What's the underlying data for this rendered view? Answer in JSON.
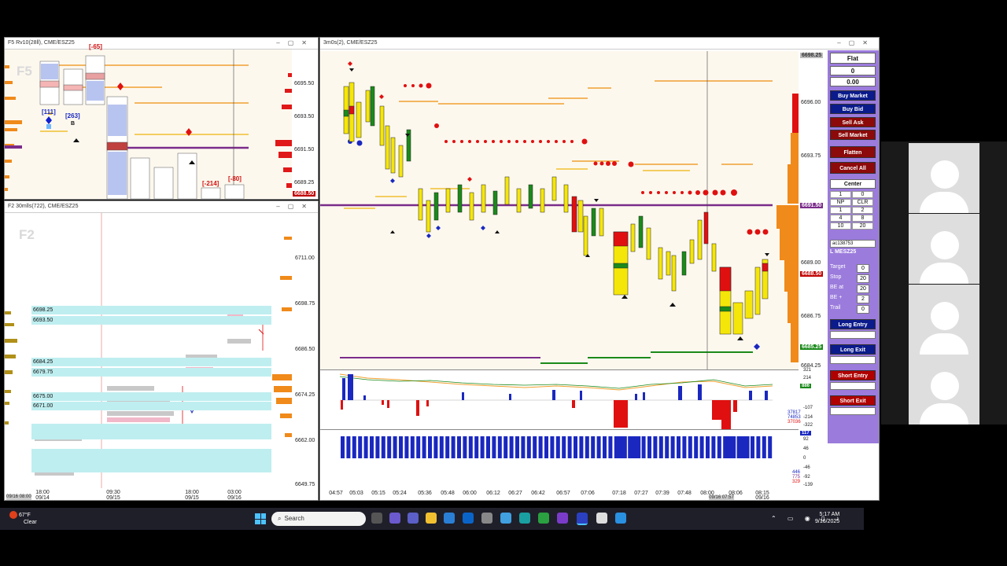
{
  "windows": {
    "f5": {
      "title": "F5 Rv10(28ll), CME/ESZ25",
      "watermark": "F5",
      "prices": [
        "6695.50",
        "6693.50",
        "6691.50",
        "6689.25"
      ],
      "last_price": "6688.50",
      "annotations": [
        "[-65]",
        "[111]",
        "[263]",
        "B",
        "[-214]",
        "[-80]"
      ]
    },
    "f2": {
      "title": "F2 30mlls(722), CME/ESZ25",
      "watermark": "F2",
      "prices": [
        "6711.00",
        "6698.75",
        "6686.50",
        "6674.25",
        "6662.00",
        "6649.75"
      ],
      "ladder": [
        "6698.25",
        "6693.50",
        "6684.25",
        "6679.75",
        "6675.00",
        "6671.00"
      ],
      "times": [
        "18:00\n09/14",
        "09:30\n09/15",
        "18:00\n09/15",
        "03:00\n09/16"
      ],
      "corner_label": "09/16 08:00"
    },
    "main": {
      "title": "3m0s(2), CME/ESZ25",
      "prices": [
        "6696.00",
        "6693.75",
        "6691.50",
        "6689.00",
        "6686.75",
        "6684.25"
      ],
      "price_tags": {
        "top": "6698.25",
        "poc": "6691.50",
        "last": "6688.50",
        "low": "6685.25"
      },
      "osc_labels": [
        "321",
        "214",
        "107",
        "0",
        "-107",
        "-214",
        "-322"
      ],
      "osc_values": [
        "37817",
        "74853",
        "37036"
      ],
      "osc_tag": "886",
      "vol_labels": [
        "92",
        "46",
        "0",
        "-46",
        "-92",
        "-139"
      ],
      "vol_values": [
        "446",
        "775",
        "329"
      ],
      "vol_tag": "117",
      "times": [
        "04:57",
        "05:03",
        "05:15",
        "05:24",
        "05:36",
        "05:48",
        "06:00",
        "06:12",
        "06:27",
        "06:42",
        "06:57",
        "07:06",
        "07:18",
        "07:27",
        "07:39",
        "07:48",
        "08:00",
        "08:06",
        "08:15"
      ],
      "time_dates": [
        "09/16",
        "09/16"
      ],
      "crosshair_time": "09/16 07:57"
    }
  },
  "order_panel": {
    "position": "Flat",
    "qty": "0",
    "pnl": "0.00",
    "buttons": [
      "Buy Market",
      "Buy Bid",
      "Sell Ask",
      "Sell Market",
      "Flatten",
      "Cancel All"
    ],
    "center": "Center",
    "qty_grid": [
      [
        "1",
        "0"
      ],
      [
        "NP",
        "CLR"
      ],
      [
        "1",
        "2"
      ],
      [
        "4",
        "8"
      ],
      [
        "10",
        "20"
      ]
    ],
    "account": "ac138753",
    "instrument": "L MESZ25",
    "fields": [
      {
        "label": "Target",
        "value": "0"
      },
      {
        "label": "Stop",
        "value": "20"
      },
      {
        "label": "BE at",
        "value": "20"
      },
      {
        "label": "BE +",
        "value": "2"
      },
      {
        "label": "Trail",
        "value": "0"
      }
    ],
    "strategy_buttons": [
      "Long Entry",
      "Long Exit",
      "Short Entry",
      "Short Exit"
    ]
  },
  "taskbar": {
    "weather_temp": "67°F",
    "weather_cond": "Clear",
    "search_placeholder": "Search",
    "time": "5:17 AM",
    "date": "9/16/2025"
  },
  "colors": {
    "accent_purple": "#9b7bdc",
    "navy": "#0b1b8c",
    "maroon": "#8c0a0a"
  }
}
